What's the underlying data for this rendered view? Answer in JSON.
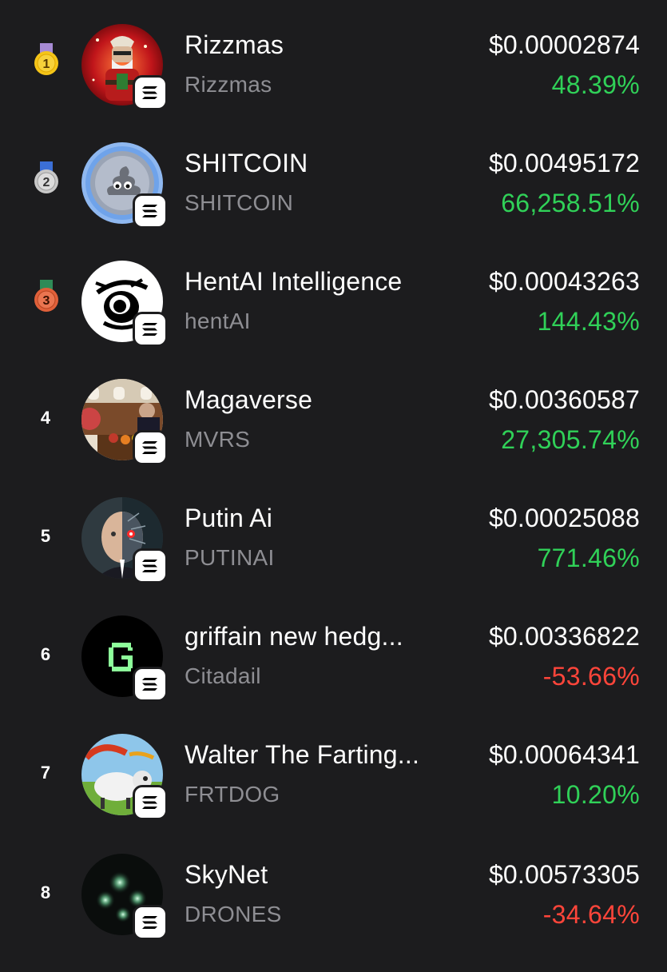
{
  "colors": {
    "background": "#1c1c1e",
    "positive": "#30d158",
    "negative": "#ff453a",
    "ticker": "#8e8e93"
  },
  "tokens": [
    {
      "rank": "1",
      "name": "Rizzmas",
      "ticker": "Rizzmas",
      "price": "$0.00002874",
      "change": "48.39%",
      "direction": "up",
      "avatar_icon": "santa-avatar-icon",
      "medal": "gold"
    },
    {
      "rank": "2",
      "name": "SHITCOIN",
      "ticker": "SHITCOIN",
      "price": "$0.00495172",
      "change": "66,258.51%",
      "direction": "up",
      "avatar_icon": "poop-coin-avatar-icon",
      "medal": "silver"
    },
    {
      "rank": "3",
      "name": "HentAI Intelligence",
      "ticker": "hentAI",
      "price": "$0.00043263",
      "change": "144.43%",
      "direction": "up",
      "avatar_icon": "anime-eye-avatar-icon",
      "medal": "bronze"
    },
    {
      "rank": "4",
      "name": "Magaverse",
      "ticker": "MVRS",
      "price": "$0.00360587",
      "change": "27,305.74%",
      "direction": "up",
      "avatar_icon": "jet-cabin-photo-avatar-icon",
      "medal": ""
    },
    {
      "rank": "5",
      "name": "Putin Ai",
      "ticker": "PUTINAI",
      "price": "$0.00025088",
      "change": "771.46%",
      "direction": "up",
      "avatar_icon": "cyborg-portrait-avatar-icon",
      "medal": ""
    },
    {
      "rank": "6",
      "name": "griffain new hedg...",
      "ticker": "Citadail",
      "price": "$0.00336822",
      "change": "-53.66%",
      "direction": "down",
      "avatar_icon": "pixel-g-avatar-icon",
      "medal": ""
    },
    {
      "rank": "7",
      "name": "Walter The Farting...",
      "ticker": "FRTDOG",
      "price": "$0.00064341",
      "change": "10.20%",
      "direction": "up",
      "avatar_icon": "book-cover-avatar-icon",
      "medal": ""
    },
    {
      "rank": "8",
      "name": "SkyNet",
      "ticker": "DRONES",
      "price": "$0.00573305",
      "change": "-34.64%",
      "direction": "down",
      "avatar_icon": "night-lights-avatar-icon",
      "medal": ""
    }
  ],
  "chain_badge_icon": "solana-icon"
}
